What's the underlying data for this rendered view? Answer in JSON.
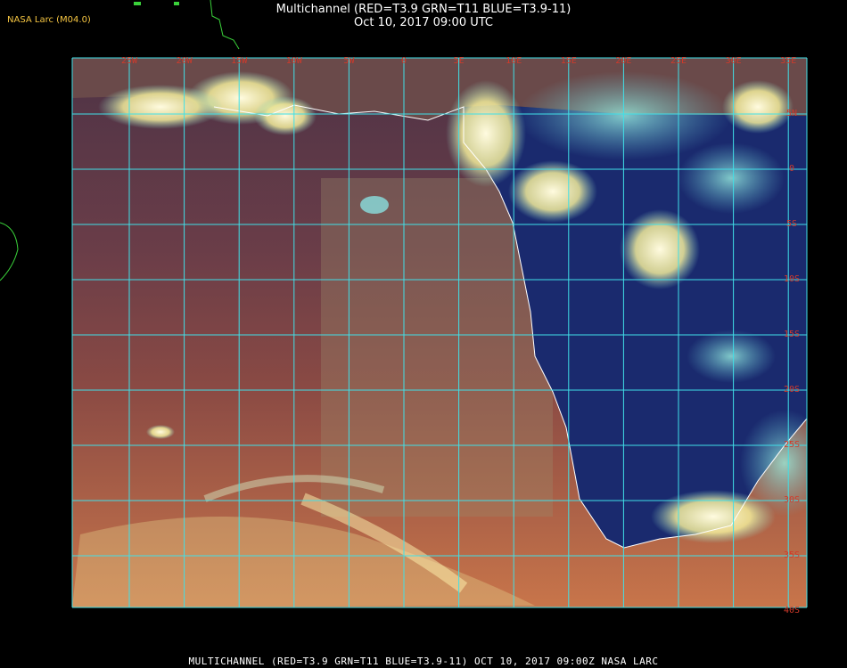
{
  "header": {
    "title": "Multichannel (RED=T3.9 GRN=T11 BLUE=T3.9-11)",
    "datetime": "Oct 10, 2017 09:00 UTC",
    "credit": "NASA Larc (M04.0)"
  },
  "footer": {
    "caption": "MULTICHANNEL (RED=T3.9 GRN=T11 BLUE=T3.9-11) OCT 10, 2017 09:00Z   NASA LARC"
  },
  "map": {
    "longitude_labels": [
      "25W",
      "20W",
      "15W",
      "10W",
      "5W",
      "0",
      "5E",
      "10E",
      "15E",
      "20E",
      "25E",
      "30E",
      "35E"
    ],
    "latitude_labels": [
      "5N",
      "0",
      "5S",
      "10S",
      "15S",
      "20S",
      "25S",
      "30S",
      "35S",
      "40S"
    ],
    "colors": {
      "grid": "#40e0e8",
      "coast": "#ffffff",
      "land": "#1a2a6e",
      "ocean_north": "#5a3a4a",
      "ocean_south": "#c0704a",
      "cloud": "#fff6b0",
      "label": "#d23a2a"
    }
  }
}
